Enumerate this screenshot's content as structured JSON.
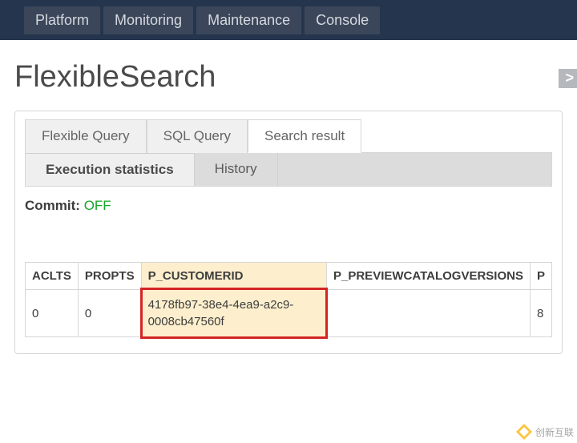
{
  "nav": {
    "items": [
      "Platform",
      "Monitoring",
      "Maintenance",
      "Console"
    ]
  },
  "page": {
    "title": "FlexibleSearch",
    "forward_glyph": ">"
  },
  "tabs": {
    "row1": [
      {
        "label": "Flexible Query",
        "active": false
      },
      {
        "label": "SQL Query",
        "active": false
      },
      {
        "label": "Search result",
        "active": true
      }
    ],
    "row2": [
      {
        "label": "Execution statistics",
        "active": true
      },
      {
        "label": "History",
        "active": false
      }
    ]
  },
  "commit": {
    "label": "Commit:",
    "value": "OFF"
  },
  "table": {
    "headers": [
      "ACLTS",
      "PROPTS",
      "P_CUSTOMERID",
      "P_PREVIEWCATALOGVERSIONS",
      "P"
    ],
    "rows": [
      {
        "aclts": "0",
        "propts": "0",
        "p_customerid": "4178fb97-38e4-4ea9-a2c9-0008cb47560f",
        "p_previewcatalogversions": "",
        "p": "8"
      }
    ],
    "highlight_col": 2
  },
  "watermark": {
    "text": "创新互联"
  }
}
